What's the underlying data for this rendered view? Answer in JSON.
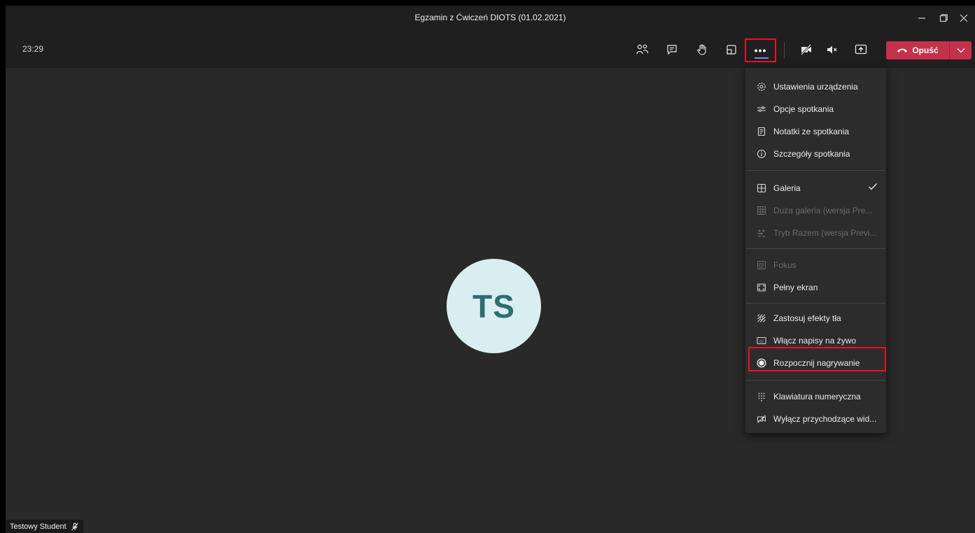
{
  "window": {
    "title": "Egzamin z Ćwiczeń DIOTS (01.02.2021)",
    "controls": [
      "minimize-icon",
      "restore-icon",
      "close-icon"
    ]
  },
  "toolbar": {
    "timer": "23:29",
    "buttons": [
      "participants-icon",
      "chat-icon",
      "raise-hand-icon",
      "rooms-icon",
      "more-actions-icon",
      "camera-off-icon",
      "mic-muted-icon",
      "share-screen-icon"
    ],
    "more_label": "•••",
    "leave_label": "Opuść",
    "accent_color": "#c4314b",
    "highlight_color": "#e81123"
  },
  "stage": {
    "avatar_initials": "TS",
    "participant_name": "Testowy Student"
  },
  "menu": {
    "items": [
      {
        "label": "Ustawienia urządzenia",
        "icon": "gear-icon",
        "disabled": false
      },
      {
        "label": "Opcje spotkania",
        "icon": "options-icon",
        "disabled": false
      },
      {
        "label": "Notatki ze spotkania",
        "icon": "notes-icon",
        "disabled": false
      },
      {
        "label": "Szczegóły spotkania",
        "icon": "info-icon",
        "disabled": false
      },
      {
        "label": "Galeria",
        "icon": "gallery-icon",
        "disabled": false,
        "checked": true
      },
      {
        "label": "Duża galeria (wersja Pre...",
        "icon": "large-gallery-icon",
        "disabled": true
      },
      {
        "label": "Tryb Razem (wersja Previ...",
        "icon": "together-mode-icon",
        "disabled": true
      },
      {
        "label": "Fokus",
        "icon": "focus-icon",
        "disabled": true
      },
      {
        "label": "Pełny ekran",
        "icon": "fullscreen-icon",
        "disabled": false
      },
      {
        "label": "Zastosuj efekty tła",
        "icon": "background-effects-icon",
        "disabled": false
      },
      {
        "label": "Włącz napisy na żywo",
        "icon": "captions-icon",
        "disabled": false
      },
      {
        "label": "Rozpocznij nagrywanie",
        "icon": "record-icon",
        "disabled": false,
        "highlighted": true
      },
      {
        "label": "Klawiatura numeryczna",
        "icon": "dialpad-icon",
        "disabled": false
      },
      {
        "label": "Wyłącz przychodzące wid...",
        "icon": "video-off-icon",
        "disabled": false
      }
    ]
  }
}
